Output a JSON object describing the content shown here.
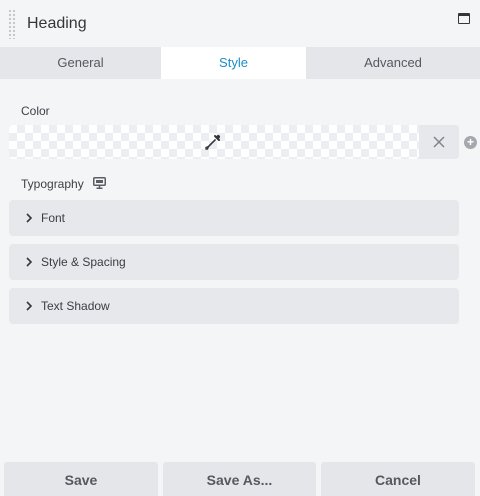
{
  "panel": {
    "title": "Heading"
  },
  "tabs": [
    {
      "label": "General",
      "active": false
    },
    {
      "label": "Style",
      "active": true
    },
    {
      "label": "Advanced",
      "active": false
    }
  ],
  "style": {
    "color_label": "Color",
    "color_value": "",
    "typography_label": "Typography",
    "sections": [
      {
        "label": "Font"
      },
      {
        "label": "Style & Spacing"
      },
      {
        "label": "Text Shadow"
      }
    ]
  },
  "footer": {
    "save_label": "Save",
    "save_as_label": "Save As...",
    "cancel_label": "Cancel"
  },
  "colors": {
    "accent": "#1a8fc4",
    "background": "#f4f5f7",
    "section_bg": "#e6e8ec"
  },
  "icons": {
    "grip": "drag-handle-icon",
    "window": "window-maximize-icon",
    "picker": "eyedropper-icon",
    "clear": "close-icon",
    "add": "plus-circle-icon",
    "responsive": "desktop-icon",
    "expand": "chevron-right-icon"
  }
}
